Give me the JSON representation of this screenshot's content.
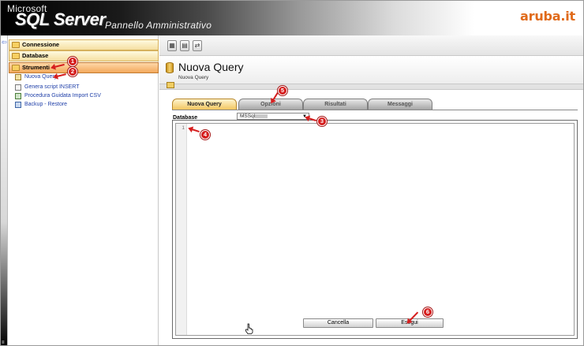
{
  "header": {
    "ms_label": "Microsoft",
    "product": "SQL Server",
    "subtitle": "Pannello Amministrativo",
    "brand": "aruba.it"
  },
  "sidebar": {
    "sections": [
      {
        "label": "Connessione"
      },
      {
        "label": "Database"
      },
      {
        "label": "Strumenti"
      }
    ],
    "items": [
      {
        "label": "Nuova Query",
        "icon": "query-icon"
      },
      {
        "label": "Genera script INSERT",
        "icon": "script-icon"
      },
      {
        "label": "Procedura Guidata Import CSV",
        "icon": "csv-icon"
      },
      {
        "label": "Backup - Restore",
        "icon": "backup-icon"
      }
    ]
  },
  "main": {
    "title": "Nuova Query",
    "breadcrumb": "Nuova Query",
    "tabs": [
      {
        "label": "Nuova Query"
      },
      {
        "label": "Opzioni"
      },
      {
        "label": "Risultati"
      },
      {
        "label": "Messaggi"
      }
    ],
    "database_label": "Database",
    "database_value": "MSSql",
    "editor_line": "1",
    "buttons": {
      "cancel": "Cancella",
      "execute": "Esegui"
    }
  },
  "annotations": [
    "1",
    "2",
    "3",
    "4",
    "5",
    "6"
  ],
  "colors": {
    "accent_red": "#d61e1e",
    "section_gold": "#f5dfa1",
    "active_orange": "#f3a95c",
    "link_blue": "#1f3fa8"
  }
}
